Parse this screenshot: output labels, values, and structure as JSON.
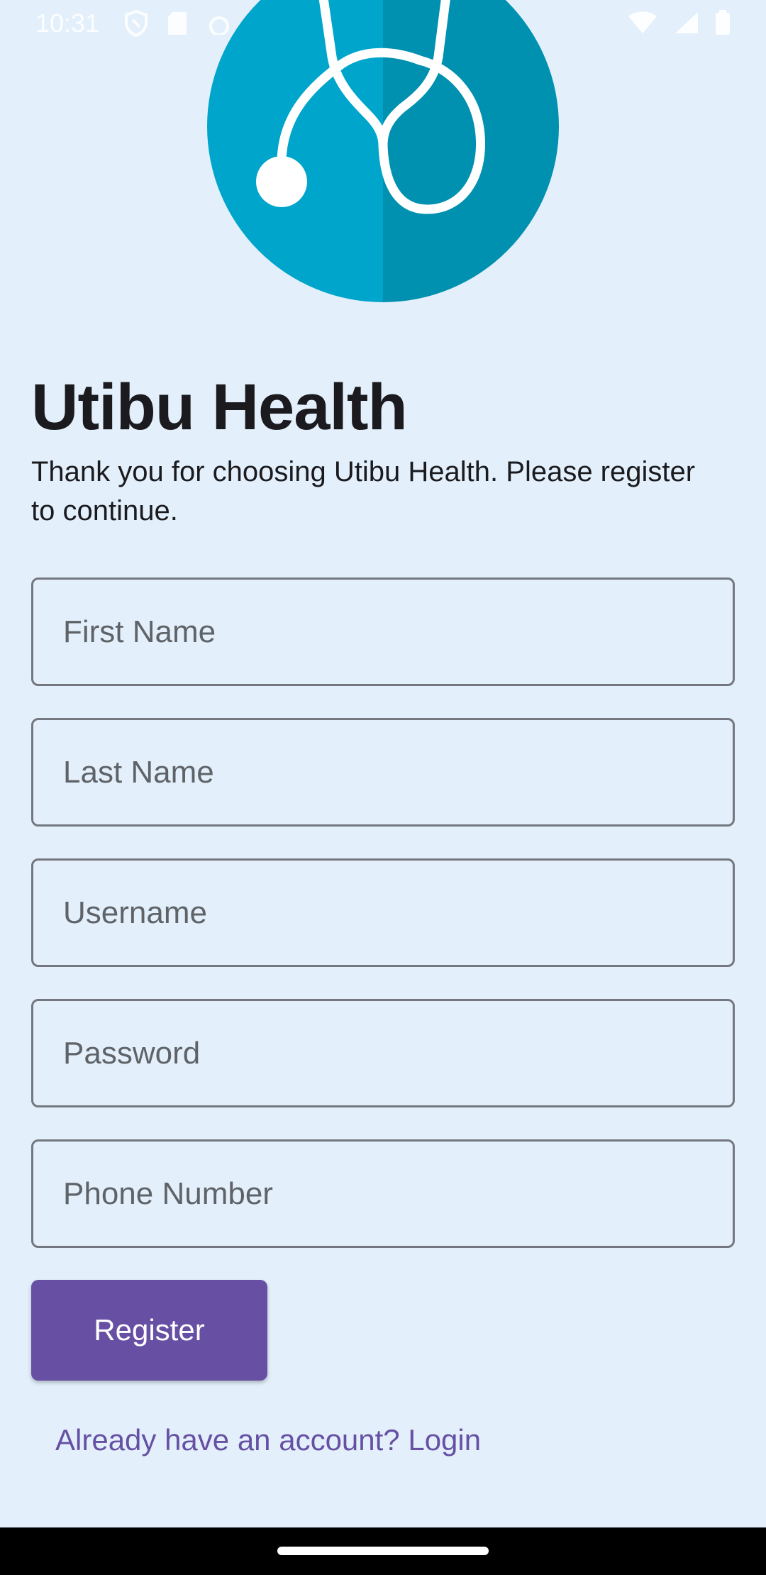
{
  "status_bar": {
    "time": "10:31",
    "left_icons": [
      "shield-icon",
      "sd-card-icon",
      "android-icon"
    ],
    "right_icons": [
      "wifi-icon",
      "signal-icon",
      "battery-icon"
    ]
  },
  "logo": {
    "icon": "stethoscope-icon",
    "colors": {
      "circle_left": "#00a5cb",
      "circle_right": "#0090b0",
      "stroke": "#ffffff"
    }
  },
  "header": {
    "title": "Utibu Health",
    "subtitle": "Thank you for choosing Utibu Health. Please register to continue."
  },
  "form": {
    "first_name": {
      "placeholder": "First Name",
      "value": ""
    },
    "last_name": {
      "placeholder": "Last Name",
      "value": ""
    },
    "username": {
      "placeholder": "Username",
      "value": ""
    },
    "password": {
      "placeholder": "Password",
      "value": ""
    },
    "phone": {
      "placeholder": "Phone Number",
      "value": ""
    },
    "register_label": "Register",
    "login_link": "Already have an account? Login"
  },
  "colors": {
    "background": "#e3f0fb",
    "primary": "#6750a4",
    "text": "#1b1b1f",
    "field_border": "#74777f"
  }
}
